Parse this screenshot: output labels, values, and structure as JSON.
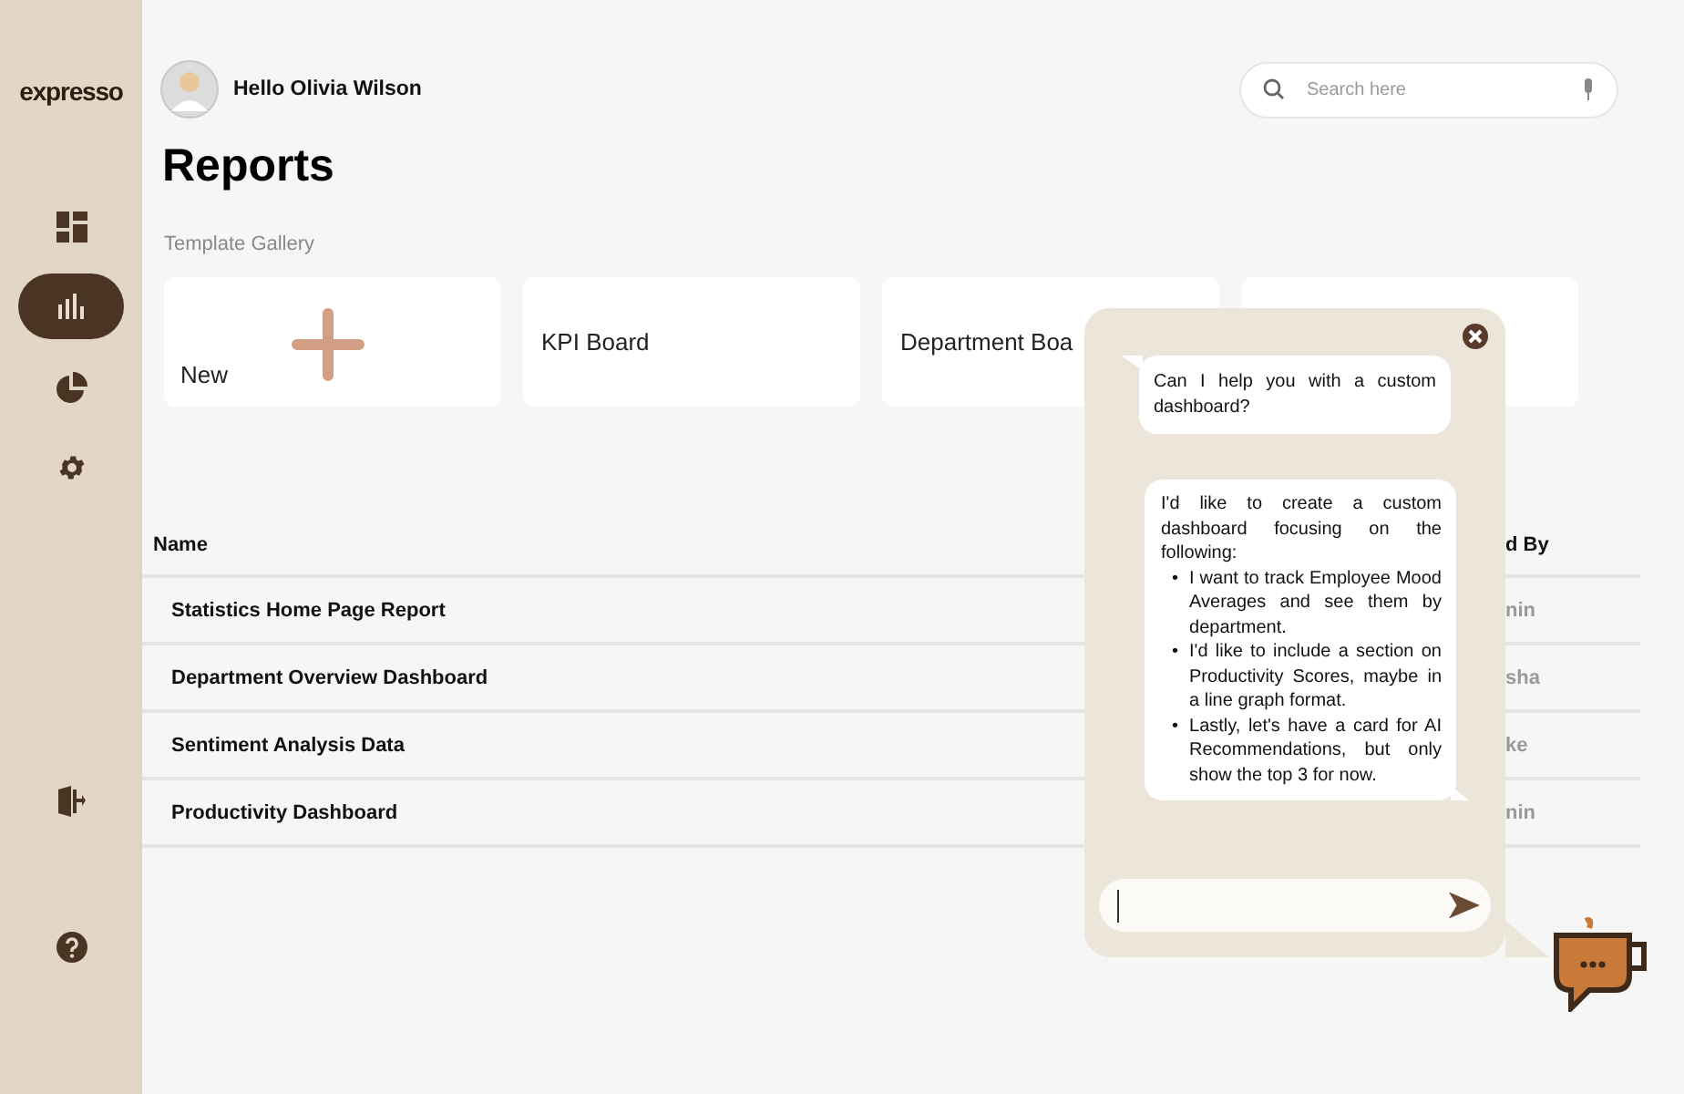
{
  "sidebar": {
    "logo": "expresso",
    "items": [
      {
        "kind": "dashboard",
        "selected": false
      },
      {
        "kind": "reports",
        "selected": true
      },
      {
        "kind": "pie",
        "selected": false
      },
      {
        "kind": "settings",
        "selected": false
      }
    ],
    "bottom_items": [
      {
        "kind": "logout"
      },
      {
        "kind": "help"
      }
    ]
  },
  "header": {
    "greeting": "Hello Olivia Wilson",
    "search": {
      "placeholder": "Search here"
    }
  },
  "title": "Reports",
  "gallery": {
    "label": "Template Gallery",
    "cards": [
      {
        "kind": "new",
        "label": "New"
      },
      {
        "kind": "template",
        "label": "KPI Board"
      },
      {
        "kind": "template",
        "label": "Department Boa"
      },
      {
        "kind": "template"
      }
    ]
  },
  "table": {
    "columns": [
      "Name",
      "d By"
    ],
    "rows": [
      {
        "name": "Statistics Home Page Report",
        "column_2": "nin"
      },
      {
        "name": "Department Overview Dashboard",
        "column_2": "sha"
      },
      {
        "name": "Sentiment Analysis Data",
        "column_2": "ke"
      },
      {
        "name": "Productivity Dashboard",
        "column_2": "nin"
      }
    ]
  },
  "chat": {
    "messages": [
      {
        "kind": "bot",
        "text": "Can I help you with a custom dashboard?"
      },
      {
        "kind": "user",
        "text": "I'd like to create a custom dashboard focusing on the following:",
        "bullets": [
          {
            "marker": "•",
            "text": "I want to track Employee Mood Averages and see them by department."
          },
          {
            "marker": "•",
            "text": "I'd like to include a section on Productivity Scores, maybe in a line graph format."
          },
          {
            "marker": "•",
            "text": "Lastly, let's have a card for AI Recommendations, but only show the top 3 for now."
          }
        ]
      }
    ]
  }
}
